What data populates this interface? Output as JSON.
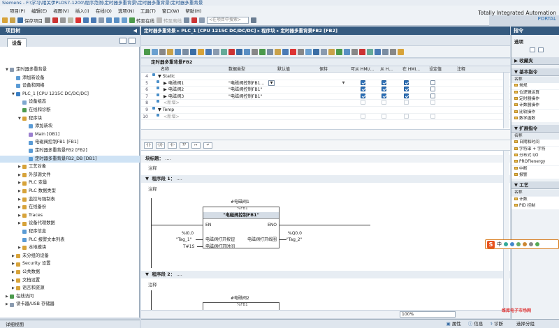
{
  "window": {
    "title": "Siemens - F:\\学习\\相关伊PLOS7-1200\\程序范例\\定时器多重背景\\定时器多重背景\\定时器多重背景"
  },
  "menu": [
    "项目(P)",
    "编辑(E)",
    "视图(V)",
    "插入(I)",
    "在线(O)",
    "选项(N)",
    "工具(T)",
    "窗口(W)",
    "帮助(H)"
  ],
  "brand": {
    "line1": "Totally Integrated Automation",
    "line2": "PORTAL"
  },
  "toolbar": {
    "save_label": "保存项目",
    "online_label": "转至在线",
    "offline_label": "转至离线",
    "search_placeholder": "<在项目中搜索>"
  },
  "left_panel": {
    "header": "项目树",
    "tab": "设备",
    "footer": "详细视图",
    "tree": [
      {
        "label": "定时器多重背景",
        "level": 0,
        "arrow": "▼",
        "color": "#8a9bb0",
        "sel": false
      },
      {
        "label": "添加新设备",
        "level": 1,
        "arrow": "",
        "color": "#5a9bd5",
        "sel": false
      },
      {
        "label": "设备和网络",
        "level": 1,
        "arrow": "",
        "color": "#5a9bd5",
        "sel": false
      },
      {
        "label": "PLC_1 [CPU 1215C DC/DC/DC]",
        "level": 1,
        "arrow": "▼",
        "color": "#3b7fc4",
        "sel": false
      },
      {
        "label": "设备组态",
        "level": 2,
        "arrow": "",
        "color": "#7fa8cf",
        "sel": false
      },
      {
        "label": "在线和诊断",
        "level": 2,
        "arrow": "",
        "color": "#4c9a4c",
        "sel": false
      },
      {
        "label": "程序块",
        "level": 2,
        "arrow": "▼",
        "color": "#d7a33a",
        "sel": false
      },
      {
        "label": "添加新块",
        "level": 3,
        "arrow": "",
        "color": "#5a9bd5",
        "sel": false
      },
      {
        "label": "Main [OB1]",
        "level": 3,
        "arrow": "",
        "color": "#9b7fcf",
        "sel": false
      },
      {
        "label": "电磁阀控制FB1 [FB1]",
        "level": 3,
        "arrow": "",
        "color": "#5a9bd5",
        "sel": false
      },
      {
        "label": "定时器多重背景FB2 [FB2]",
        "level": 3,
        "arrow": "",
        "color": "#5a9bd5",
        "sel": false
      },
      {
        "label": "定时器多重背景FB2_DB [DB1]",
        "level": 3,
        "arrow": "",
        "color": "#5a9bd5",
        "sel": true
      },
      {
        "label": "工艺对象",
        "level": 2,
        "arrow": "▶",
        "color": "#d7a33a",
        "sel": false
      },
      {
        "label": "外部源文件",
        "level": 2,
        "arrow": "▶",
        "color": "#d7a33a",
        "sel": false
      },
      {
        "label": "PLC 变量",
        "level": 2,
        "arrow": "▶",
        "color": "#d7a33a",
        "sel": false
      },
      {
        "label": "PLC 数据类型",
        "level": 2,
        "arrow": "▶",
        "color": "#d7a33a",
        "sel": false
      },
      {
        "label": "监控与强制表",
        "level": 2,
        "arrow": "▶",
        "color": "#d7a33a",
        "sel": false
      },
      {
        "label": "在线备份",
        "level": 2,
        "arrow": "▶",
        "color": "#d7a33a",
        "sel": false
      },
      {
        "label": "Traces",
        "level": 2,
        "arrow": "▶",
        "color": "#d7a33a",
        "sel": false
      },
      {
        "label": "设备代理数据",
        "level": 2,
        "arrow": "▶",
        "color": "#d7a33a",
        "sel": false
      },
      {
        "label": "程序信息",
        "level": 2,
        "arrow": "",
        "color": "#5a9bd5",
        "sel": false
      },
      {
        "label": "PLC 报警文本列表",
        "level": 2,
        "arrow": "",
        "color": "#5a9bd5",
        "sel": false
      },
      {
        "label": "本地模块",
        "level": 2,
        "arrow": "▶",
        "color": "#d7a33a",
        "sel": false
      },
      {
        "label": "未分组的设备",
        "level": 1,
        "arrow": "▶",
        "color": "#d7a33a",
        "sel": false
      },
      {
        "label": "Security 设置",
        "level": 1,
        "arrow": "▶",
        "color": "#d7a33a",
        "sel": false
      },
      {
        "label": "公共数据",
        "level": 1,
        "arrow": "▶",
        "color": "#d7a33a",
        "sel": false
      },
      {
        "label": "文档设置",
        "level": 1,
        "arrow": "▶",
        "color": "#d7a33a",
        "sel": false
      },
      {
        "label": "语言和资源",
        "level": 1,
        "arrow": "▶",
        "color": "#d7a33a",
        "sel": false
      },
      {
        "label": "在线访问",
        "level": 0,
        "arrow": "▶",
        "color": "#4c9a4c",
        "sel": false
      },
      {
        "label": "读卡器/USB 存储器",
        "level": 0,
        "arrow": "▶",
        "color": "#8a9bb0",
        "sel": false
      }
    ]
  },
  "editor": {
    "breadcrumb": "定时器多重背景 ▸ PLC_1 [CPU 1215C DC/DC/DC] ▸ 程序块 ▸ 定时器多重背景FB2 [FB2]",
    "block_name": "定时器多重背景FB2",
    "iface_headers": {
      "name": "名称",
      "type": "数据类型",
      "default": "默认值",
      "hold": "保持",
      "hmi_access": "可从 HMI/...",
      "hmi_write": "从 H...",
      "hmi_visible": "在 HMI...",
      "setpoint": "设定值",
      "comment": "注释"
    },
    "iface_rows": [
      {
        "num": "4",
        "name": "▼ Static",
        "type": "",
        "indent": 0,
        "checks": [
          false,
          false,
          false,
          false
        ],
        "faint": false
      },
      {
        "num": "5",
        "name": "▶ 电磁阀1",
        "type": "\"电磁阀控制FB1...",
        "indent": 1,
        "checks": [
          true,
          true,
          true,
          false
        ],
        "faint": false
      },
      {
        "num": "6",
        "name": "▶ 电磁阀2",
        "type": "\"电磁阀控制FB1\"",
        "indent": 1,
        "checks": [
          true,
          true,
          true,
          false
        ],
        "faint": false
      },
      {
        "num": "7",
        "name": "▶ 电磁阀3",
        "type": "\"电磁阀控制FB1\"",
        "indent": 1,
        "checks": [
          true,
          true,
          true,
          false
        ],
        "faint": false
      },
      {
        "num": "8",
        "name": "<新增>",
        "type": "",
        "indent": 1,
        "checks": [
          false,
          false,
          false,
          false
        ],
        "faint": true
      },
      {
        "num": "9",
        "name": "▼ Temp",
        "type": "",
        "indent": 0,
        "checks": [
          false,
          false,
          false,
          false
        ],
        "faint": false
      },
      {
        "num": "10",
        "name": "<新增>",
        "type": "",
        "indent": 1,
        "checks": [
          false,
          false,
          false,
          false
        ],
        "faint": true
      }
    ],
    "ladder_tools": [
      "-||-",
      "-|/|-",
      "-()-",
      "??",
      "↦",
      "↵"
    ],
    "block_title_label": "块标题：",
    "block_title_dots": "....",
    "block_comment": "注释",
    "network1": {
      "title": "程序段 1：",
      "dots": "....",
      "comment": "注释",
      "instance": "#电磁阀1",
      "instance_db": "%FB1",
      "fb_name": "\"电磁阀控制FB1\"",
      "en": "EN",
      "eno": "ENO",
      "in_addr": "%I0.0",
      "in_tag": "\"Tag_1\"",
      "in_pin": "电磁阀打开按钮",
      "in2_addr": "T#1S",
      "in2_pin": "电磁阀打开时间",
      "out_pin": "电磁阀打开线圈",
      "out_addr": "%Q0.0",
      "out_tag": "\"Tag_2\""
    },
    "network2": {
      "title": "程序段 2：",
      "dots": "....",
      "comment": "注释",
      "instance": "#电磁阀2",
      "instance_db": "%FB1"
    },
    "zoom": "100%"
  },
  "bottom_tabs": [
    "属性",
    "信息",
    "诊断"
  ],
  "right_panel": {
    "header": "指令",
    "options_label": "选项",
    "sections": [
      {
        "title": "▶ 收藏夹",
        "items": []
      },
      {
        "title": "▼ 基本指令",
        "items": [
          "名称",
          "常规",
          "位逻辑运算",
          "定时器操作",
          "计数器操作",
          "比较操作",
          "数学函数"
        ]
      },
      {
        "title": "▼ 扩展指令",
        "items": [
          "名称",
          "日期和时间",
          "字符串 + 字符",
          "分布式 I/O",
          "PROFIenergy",
          "中断",
          "报警"
        ]
      },
      {
        "title": "▼ 工艺",
        "items": [
          "名称",
          "计数",
          "PID 控制"
        ]
      }
    ],
    "vtabs": [
      "指令",
      "测试",
      "任务",
      "库"
    ],
    "footer": "选择分组"
  },
  "watermark": "维库电子市场网"
}
